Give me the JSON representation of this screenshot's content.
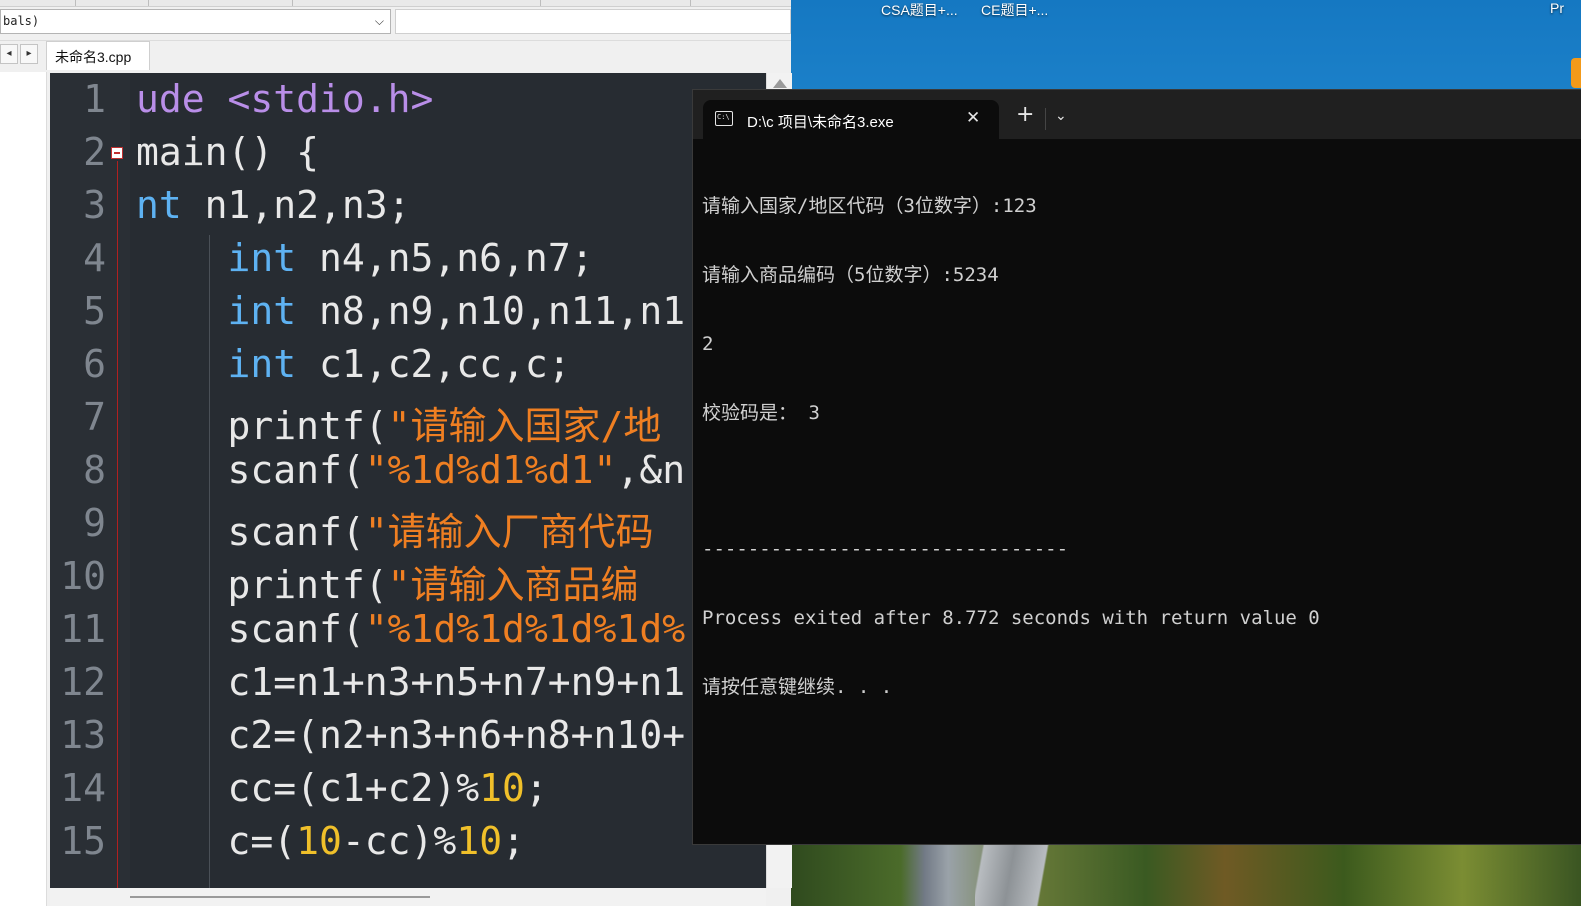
{
  "desktop": {
    "icons": [
      {
        "label": "CSA题目+..."
      },
      {
        "label": "CE题目+..."
      },
      {
        "label": "Pr"
      }
    ]
  },
  "ide": {
    "scope_select_value": "bals)",
    "file_tab": "未命名3.cpp",
    "nav_prev": "◂",
    "nav_next": "▸",
    "line_numbers": [
      "1",
      "2",
      "3",
      "4",
      "5",
      "6",
      "7",
      "8",
      "9",
      "10",
      "11",
      "12",
      "13",
      "14",
      "15"
    ]
  },
  "code_lines": [
    [
      "ude",
      " ",
      "<stdio.h>"
    ],
    [
      "main() {"
    ],
    [
      "nt",
      " n1,n2,n3;"
    ],
    [
      "    ",
      "int",
      " n4,n5,n6,n7;"
    ],
    [
      "    ",
      "int",
      " n8,n9,n10,n11,n1"
    ],
    [
      "    ",
      "int",
      " c1,c2,cc,c;"
    ],
    [
      "    printf(",
      "\"请输入国家/地"
    ],
    [
      "    scanf(",
      "\"%1d%d1%d1\"",
      ",&n"
    ],
    [
      "    scanf(",
      "\"请输入厂商代码"
    ],
    [
      "    printf(",
      "\"请输入商品编"
    ],
    [
      "    scanf(",
      "\"%1d%1d%1d%1d%"
    ],
    [
      "    c1=n1+n3+n5+n7+n9+n1"
    ],
    [
      "    c2=(n2+n3+n6+n8+n10+"
    ],
    [
      "    cc=(c1+c2)%",
      "10",
      ";"
    ],
    [
      "    c=(",
      "10",
      "-cc)%",
      "10",
      ";"
    ]
  ],
  "terminal": {
    "tab_title": "D:\\c 项目\\未命名3.exe",
    "icon_text": "C:\\",
    "close_glyph": "✕",
    "new_tab_glyph": "+",
    "dropdown_glyph": "⌄",
    "output_lines": [
      "请输入国家/地区代码（3位数字）:123",
      "请输入商品编码（5位数字）:5234",
      "2",
      "校验码是： 3",
      "",
      "--------------------------------",
      "Process exited after 8.772 seconds with return value 0",
      "请按任意键继续. . ."
    ]
  }
}
